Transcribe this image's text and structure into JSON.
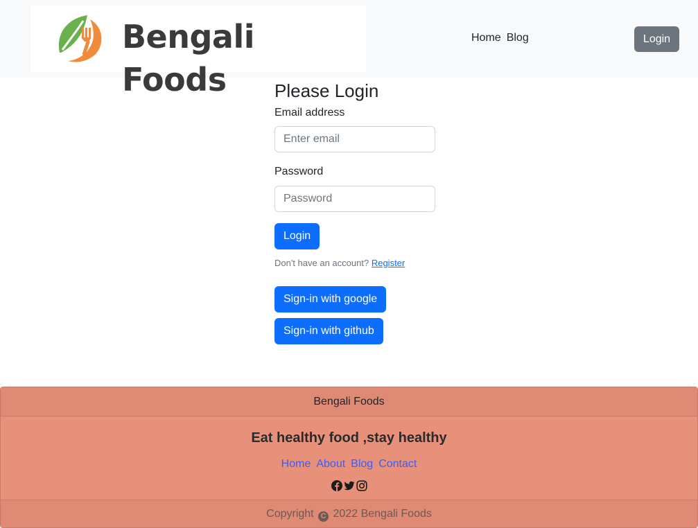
{
  "header": {
    "brand": "Bengali Foods",
    "nav": [
      "Home",
      "Blog"
    ],
    "login_button": "Login"
  },
  "form": {
    "title": "Please Login",
    "email_label": "Email address",
    "email_placeholder": "Enter email",
    "password_label": "Password",
    "password_placeholder": "Password",
    "submit": "Login",
    "register_prompt": "Don't have an account?",
    "register_link": "Register",
    "google_button": "Sign-in with google",
    "github_button": "Sign-in with github"
  },
  "footer": {
    "header": "Bengali Foods",
    "tagline": "Eat healthy food ,stay healthy",
    "links": [
      "Home",
      "About",
      "Blog",
      "Contact"
    ],
    "social_icons": [
      "facebook-icon",
      "twitter-icon",
      "instagram-icon"
    ],
    "copyright_prefix": "Copyright",
    "copyright_suffix": "2022 Bengali Foods"
  },
  "colors": {
    "primary": "#0d6efd",
    "secondary": "#6c757d",
    "footer_bg": "#e8917a",
    "logo_green": "#6ab04c",
    "logo_orange": "#f08a3c"
  }
}
